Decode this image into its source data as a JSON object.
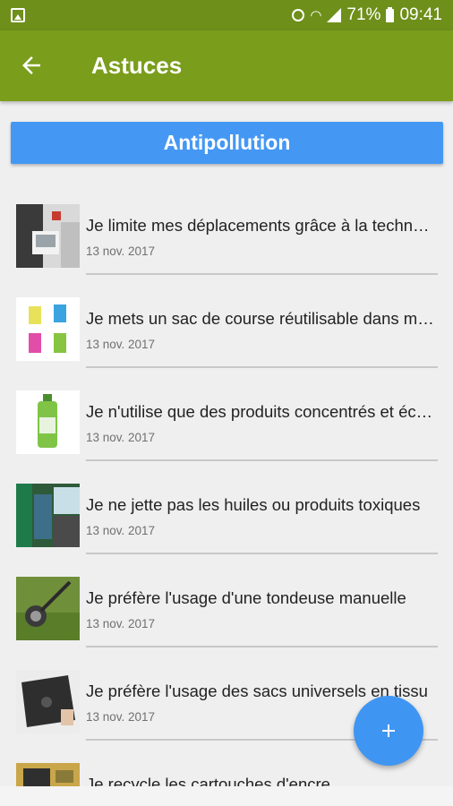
{
  "status_bar": {
    "battery": "71%",
    "time": "09:41",
    "icons": [
      "gallery-icon",
      "alarm-icon",
      "wifi-icon",
      "signal-icon",
      "battery-icon"
    ]
  },
  "app_bar": {
    "title": "Astuces",
    "back_icon": "arrow-left-icon"
  },
  "category": {
    "label": "Antipollution",
    "color": "#4498f4"
  },
  "theme": {
    "app_bar_color": "#7a9d1c",
    "status_bar_color": "#6e8f1a",
    "fab_color": "#3f96f2"
  },
  "tips": [
    {
      "title": "Je limite mes déplacements grâce à la technologie",
      "date": "13 nov. 2017",
      "thumb": "car-interior-photo"
    },
    {
      "title": "Je mets un sac de course réutilisable dans mon sac",
      "date": "13 nov. 2017",
      "thumb": "reusable-bags-photo"
    },
    {
      "title": "Je n'utilise que des produits concentrés et écologiques",
      "date": "13 nov. 2017",
      "thumb": "detergent-bottle-photo"
    },
    {
      "title": "Je ne jette pas les huiles ou produits toxiques",
      "date": "13 nov. 2017",
      "thumb": "recycling-bins-photo"
    },
    {
      "title": "Je préfère l'usage d'une tondeuse manuelle",
      "date": "13 nov. 2017",
      "thumb": "lawn-mower-photo"
    },
    {
      "title": "Je préfère l'usage des sacs universels en tissu",
      "date": "13 nov. 2017",
      "thumb": "vacuum-bag-photo"
    },
    {
      "title": "Je recycle les cartouches d'encre",
      "date": "",
      "thumb": "ink-cartridge-photo"
    }
  ],
  "fab": {
    "icon": "plus-icon"
  }
}
